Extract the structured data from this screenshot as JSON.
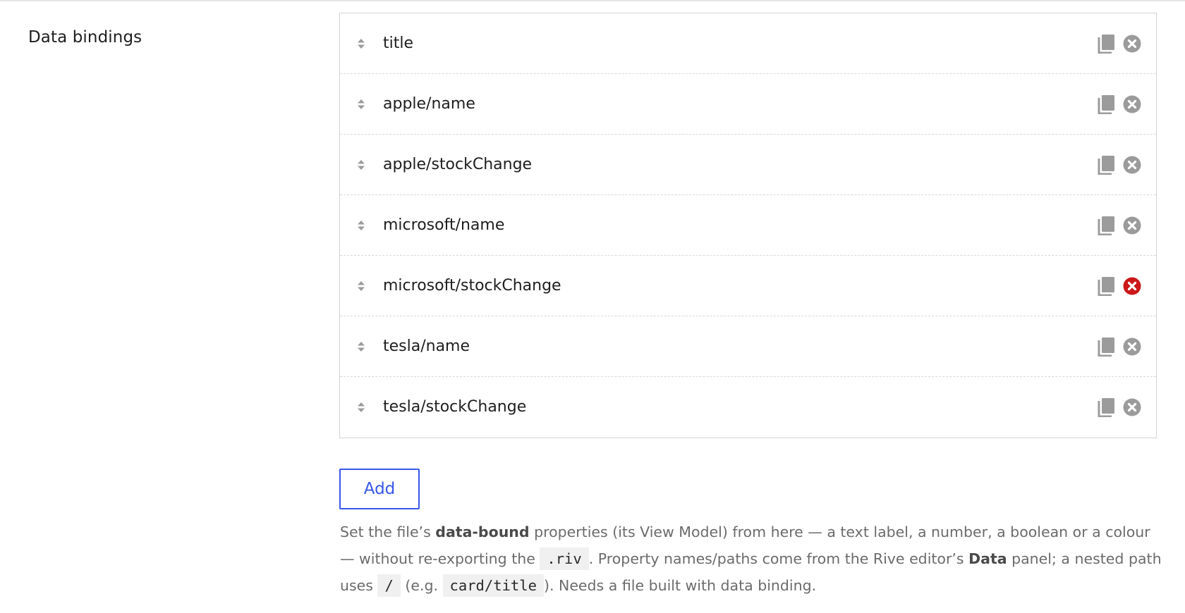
{
  "section": {
    "label": "Data bindings"
  },
  "bindings": [
    {
      "label": "title"
    },
    {
      "label": "apple/name"
    },
    {
      "label": "apple/stockChange"
    },
    {
      "label": "microsoft/name"
    },
    {
      "label": "microsoft/stockChange",
      "remove_hovered": true
    },
    {
      "label": "tesla/name"
    },
    {
      "label": "tesla/stockChange"
    }
  ],
  "icons": {
    "drag": "drag-handle-icon",
    "copy": "copy-icon",
    "remove": "remove-icon"
  },
  "colors": {
    "accent": "#3858e9",
    "icon_gray": "#9b9b9b",
    "remove_hover": "#cc1818",
    "help_text": "#6b6b6b"
  },
  "add_button": {
    "label": "Add"
  },
  "help": {
    "t1": "Set the file’s ",
    "b1": "data-bound",
    "t2": " properties (its View Model) from here — a text label, a number, a boolean or a colour — without re-exporting the ",
    "c1": ".riv",
    "t3": ". Property names/paths come from the Rive editor’s ",
    "b2": "Data",
    "t4": " panel; a nested path uses ",
    "c2": "/",
    "t5": " (e.g. ",
    "c3": "card/title",
    "t6": "). Needs a file built with data binding."
  }
}
